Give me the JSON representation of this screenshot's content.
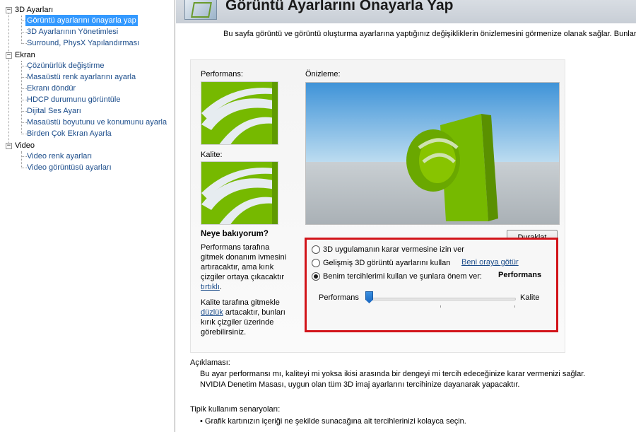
{
  "sidebar": {
    "groups": [
      {
        "label": "3D Ayarları",
        "expander": "−",
        "items": [
          {
            "label": "Görüntü ayarlarını önayarla yap",
            "selected": true
          },
          {
            "label": "3D Ayarlarının Yönetimlesi"
          },
          {
            "label": "Surround, PhysX Yapılandırması"
          }
        ]
      },
      {
        "label": "Ekran",
        "expander": "−",
        "items": [
          {
            "label": "Çözünürlük değiştirme"
          },
          {
            "label": "Masaüstü renk ayarlarını ayarla"
          },
          {
            "label": "Ekranı döndür"
          },
          {
            "label": "HDCP durumunu görüntüle"
          },
          {
            "label": "Dijital Ses Ayarı"
          },
          {
            "label": "Masaüstü boyutunu ve konumunu ayarla"
          },
          {
            "label": "Birden Çok Ekran Ayarla"
          }
        ]
      },
      {
        "label": "Video",
        "expander": "−",
        "items": [
          {
            "label": "Video renk ayarları"
          },
          {
            "label": "Video görüntüsü ayarları"
          }
        ]
      }
    ]
  },
  "header": {
    "title": "Görüntü Ayarlarını Önayarla Yap"
  },
  "intro": "Bu sayfa görüntü ve görüntü oluşturma ayarlarına yaptığınız değişikliklerin önizlemesini görmenize olanak sağlar. Bunlar Direct",
  "panel": {
    "performance_label": "Performans:",
    "quality_label": "Kalite:",
    "preview_label": "Önizleme:",
    "what_title": "Neye bakıyorum?",
    "perf_para_before": "Performans tarafına gitmek donanım ivmesini artıracaktır, ama kırık çizgiler ortaya çıkacaktır",
    "perf_link": "tırtıklı",
    "perf_para_after": ".",
    "qual_para_before": "Kalite tarafına gitmekle",
    "qual_link": "düzlük",
    "qual_para_after": "artacaktır, bunları kırık çizgiler üzerinde görebilirsiniz.",
    "pause_button": "Duraklat"
  },
  "options": {
    "radio1": "3D uygulamanın karar vermesine izin ver",
    "radio2": "Gelişmiş 3D görüntü ayarlarını kullan",
    "radio2_link": "Beni oraya götür",
    "radio3": "Benim tercihlerimi kullan ve şunlara önem ver:",
    "radio3_value": "Performans",
    "selected": "radio3",
    "slider_left": "Performans",
    "slider_right": "Kalite",
    "slider_position": 0.0
  },
  "description": {
    "title": "Açıklaması:",
    "line1": "Bu ayar performansı mı, kaliteyi mi yoksa ikisi arasında bir dengeyi mi tercih edeceğinize karar vermenizi sağlar.",
    "line2": "NVIDIA Denetim Masası, uygun olan tüm 3D imaj ayarlarını tercihinize dayanarak yapacaktır."
  },
  "typical": {
    "title": "Tipik kullanım senaryoları:",
    "item1": "Grafik kartınızın içeriği ne şekilde sunacağına ait tercihlerinizi kolayca seçin."
  },
  "colors": {
    "accent_red": "#d2141a",
    "selection_blue": "#3399ff",
    "link_blue": "#1b4c8a",
    "nvidia_green": "#76b900"
  }
}
